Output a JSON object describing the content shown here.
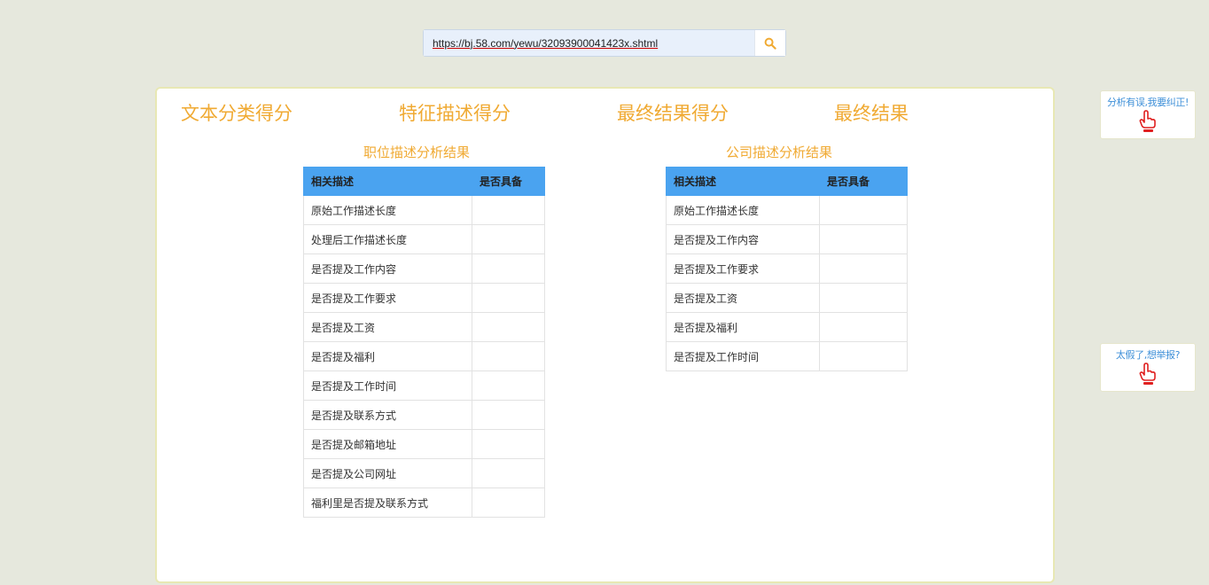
{
  "search": {
    "url_value": "https://bj.58.com/yewu/32093900041423x.shtml"
  },
  "icons": {
    "search": "search-icon",
    "hand": "pointing-hand-icon"
  },
  "scores": {
    "text_class": "文本分类得分",
    "feature_desc": "特征描述得分",
    "final_score": "最终结果得分",
    "final_result": "最终结果"
  },
  "job_table": {
    "title": "职位描述分析结果",
    "headers": [
      "相关描述",
      "是否具备"
    ],
    "rows": [
      "原始工作描述长度",
      "处理后工作描述长度",
      "是否提及工作内容",
      "是否提及工作要求",
      "是否提及工资",
      "是否提及福利",
      "是否提及工作时间",
      "是否提及联系方式",
      "是否提及邮箱地址",
      "是否提及公司网址",
      "福利里是否提及联系方式"
    ]
  },
  "company_table": {
    "title": "公司描述分析结果",
    "headers": [
      "相关描述",
      "是否具备"
    ],
    "rows": [
      "原始工作描述长度",
      "是否提及工作内容",
      "是否提及工作要求",
      "是否提及工资",
      "是否提及福利",
      "是否提及工作时间"
    ]
  },
  "side": {
    "correct": "分析有误,我要纠正!",
    "report": "太假了,想举报?"
  },
  "colors": {
    "accent_orange": "#f0aa33",
    "table_header_blue": "#4aa3f0",
    "link_blue": "#3d8fd8",
    "hand_red": "#e02020"
  }
}
